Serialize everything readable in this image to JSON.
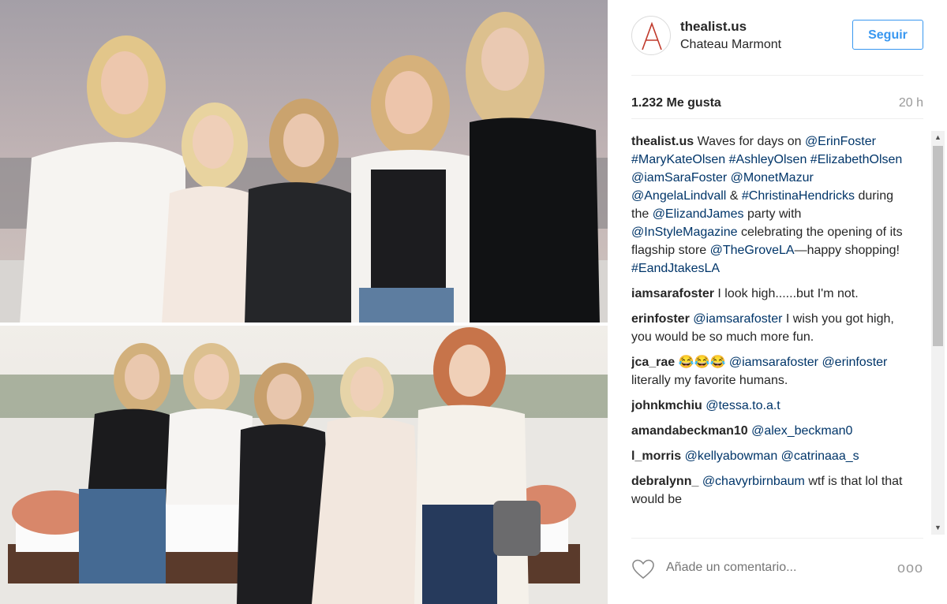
{
  "post": {
    "username": "thealist.us",
    "location": "Chateau Marmont",
    "follow_label": "Seguir",
    "likes": "1.232 Me gusta",
    "time": "20 h"
  },
  "caption": {
    "user": "thealist.us",
    "t1": " Waves for days on ",
    "m1": "@ErinFoster",
    "t2": " ",
    "m2": "#MaryKateOlsen",
    "t3": " ",
    "m3": "#AshleyOlsen",
    "t4": " ",
    "m4": "#ElizabethOlsen",
    "t5": " ",
    "m5": "@iamSaraFoster",
    "t6": " ",
    "m6": "@MonetMazur",
    "t7": " ",
    "m7": "@AngelaLindvall",
    "t8": " & ",
    "m8": "#ChristinaHendricks",
    "t9": " during the ",
    "m9": "@ElizandJames",
    "t10": " party with ",
    "m10": "@InStyleMagazine",
    "t11": " celebrating the opening of its flagship store ",
    "m11": "@TheGroveLA",
    "t12": "—happy shopping! ",
    "m12": "#EandJtakesLA"
  },
  "comments": [
    {
      "user": "iamsarafoster",
      "pre": "",
      "mention": "",
      "text": " I look high......but I'm not."
    },
    {
      "user": "erinfoster",
      "pre": " ",
      "mention": "@iamsarafoster",
      "text": " I wish you got high, you would be so much more fun."
    },
    {
      "user": "jca_rae",
      "pre": " 😂😂😂 ",
      "mention": "@iamsarafoster @erinfoster",
      "text": " literally my favorite humans."
    },
    {
      "user": "johnkmchiu",
      "pre": " ",
      "mention": "@tessa.to.a.t",
      "text": ""
    },
    {
      "user": "amandabeckman10",
      "pre": " ",
      "mention": "@alex_beckman0",
      "text": ""
    },
    {
      "user": "l_morris",
      "pre": " ",
      "mention": "@kellyabowman @catrinaaa_s",
      "text": ""
    },
    {
      "user": "debralynn_",
      "pre": " ",
      "mention": "@chavyrbirnbaum",
      "text": " wtf is that lol that would be"
    }
  ],
  "footer": {
    "placeholder": "Añade un comentario...",
    "more": "ooo"
  },
  "icons": {
    "heart": "heart-icon",
    "more": "more-options-icon",
    "avatar": "brand-logo-A"
  },
  "colors": {
    "follow": "#3897f0",
    "link": "#003569",
    "muted": "#999999"
  }
}
